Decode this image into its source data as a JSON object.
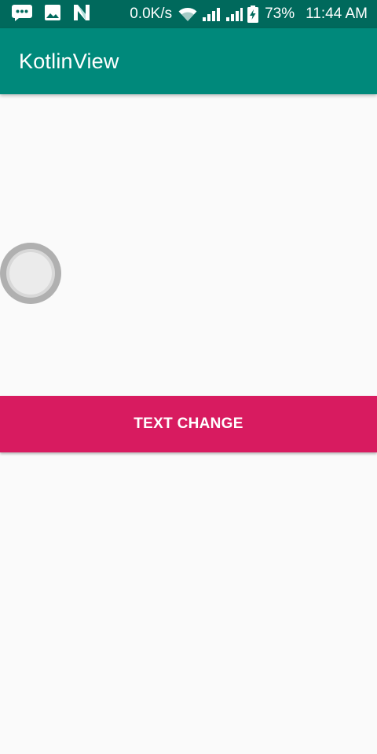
{
  "status_bar": {
    "notification_icons": [
      "message-icon",
      "image-icon",
      "n-icon"
    ],
    "net_speed": "0.0K/s",
    "battery_percent": "73%",
    "time": "11:44 AM",
    "background_color": "#00695c"
  },
  "app_bar": {
    "title": "KotlinView",
    "background_color": "#00897b"
  },
  "main": {
    "radio_button": {
      "checked": false
    },
    "text_change_button": {
      "label": "TEXT CHANGE",
      "background_color": "#d81b60"
    }
  }
}
